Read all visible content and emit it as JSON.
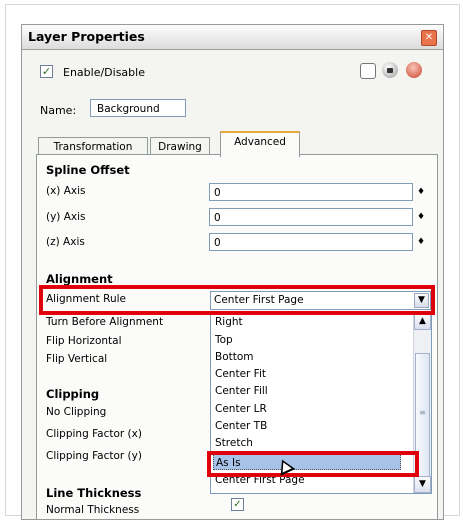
{
  "window": {
    "title": "Layer Properties",
    "close_glyph": "✕"
  },
  "enable": {
    "label": "Enable/Disable",
    "checked": true,
    "check_glyph": "✓"
  },
  "name_field": {
    "label": "Name:",
    "value": "Background"
  },
  "tabs": [
    {
      "label": "Transformation",
      "active": false
    },
    {
      "label": "Drawing",
      "active": false
    },
    {
      "label": "Advanced",
      "active": true
    }
  ],
  "spline_offset": {
    "heading": "Spline Offset",
    "rows": [
      {
        "label": "(x) Axis",
        "value": "0"
      },
      {
        "label": "(y) Axis",
        "value": "0"
      },
      {
        "label": "(z) Axis",
        "value": "0"
      }
    ],
    "spin_glyph": "♦"
  },
  "alignment": {
    "heading": "Alignment",
    "rule_label": "Alignment Rule",
    "rule_value": "Center First Page",
    "other_labels": [
      "Turn Before Alignment",
      "Flip Horizontal",
      "Flip Vertical"
    ],
    "dropdown_arrow": "▼",
    "options": [
      "Right",
      "Top",
      "Bottom",
      "Center Fit",
      "Center Fill",
      "Center LR",
      "Center TB",
      "Stretch",
      "As Is",
      "Center First Page"
    ],
    "selected_option": "As Is",
    "scroll_up": "▲",
    "scroll_down": "▼"
  },
  "clipping": {
    "heading": "Clipping",
    "labels": [
      "No Clipping",
      "Clipping Factor (x)",
      "Clipping Factor (y)"
    ]
  },
  "line_thickness": {
    "heading": "Line Thickness",
    "normal_label": "Normal Thickness",
    "normal_checked": true
  },
  "colors": {
    "highlight_red": "#e0000b",
    "active_tab_accent": "#e8a93b",
    "selection_blue": "#a8c3e8"
  }
}
